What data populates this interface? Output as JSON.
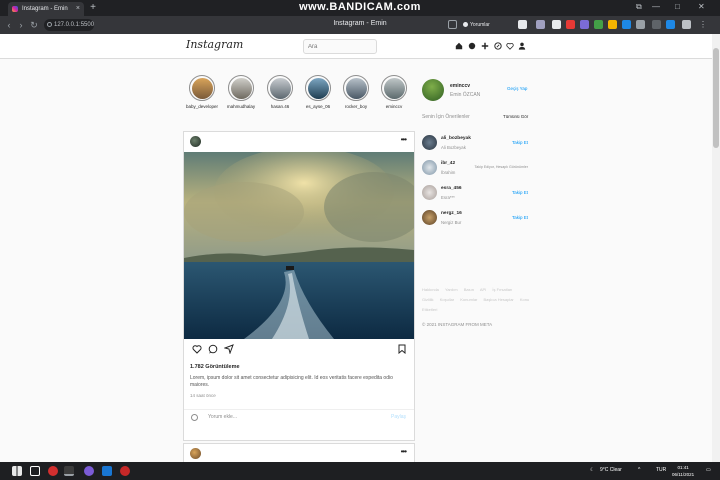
{
  "browser": {
    "tab_title": "Instagram - Emin",
    "tab_close": "×",
    "new_tab": "+",
    "recorder_watermark": "www.BANDICAM.com",
    "page_title": "Instagram - Emin",
    "url": "127.0.0.1:5500",
    "comments_ext_label": "Yorumlar",
    "window_controls": [
      "⧉",
      "—",
      "□",
      "✕"
    ]
  },
  "header": {
    "logo": "Instagram",
    "search_placeholder": "Ara"
  },
  "stories": [
    {
      "name": "baby_developer",
      "color": "#c79560"
    },
    {
      "name": "mahmudhalay",
      "color": "#a89c8a"
    },
    {
      "name": "hasan.46",
      "color": "#8b9aa5"
    },
    {
      "name": "es_ayse_06",
      "color": "#3f6d8a"
    },
    {
      "name": "rocker_boy",
      "color": "#6a7d8c"
    },
    {
      "name": "eminccv",
      "color": "#7e8c8f"
    }
  ],
  "post": {
    "menu": "•••",
    "views": "1.782 Görüntüleme",
    "caption": "Lorem, ipsum dolor sit amet consectetur adipisicing elit. Id eos veritatis facere expedita odio maiores.",
    "time": "14 saat önce",
    "comment_placeholder": "Yorum ekle...",
    "comment_button": "Paylaş",
    "menu2": "•••"
  },
  "sidebar": {
    "username": "eminccv",
    "fullname": "Emin ÖZCAN",
    "switch": "Geçiş Yap",
    "suggestions_title": "Senin İçin Önerilenler",
    "see_all": "Tümünü Gör",
    "suggestions": [
      {
        "username": "ali_bozbeyak",
        "name": "Ali Bozbeyak",
        "action": "Takip Et",
        "color": "#4a5a6a"
      },
      {
        "username": "ibr_42",
        "name": "İbrahim",
        "action": "Takip Ediyor, Hesaplı Görünümler",
        "color": "#7f95a8"
      },
      {
        "username": "esra_456",
        "name": "Esra***",
        "action": "Takip Et",
        "color": "#c2b9b5"
      },
      {
        "username": "nergz_16",
        "name": "Nergiz Bur",
        "action": "Takip Et",
        "color": "#8a6d4a"
      }
    ],
    "footer_links": [
      "Hakkında",
      "Yardım",
      "Basın",
      "API",
      "İş Fırsatları",
      "Gizlilik",
      "Koşullar",
      "Konumlar",
      "Başlıca Hesaplar",
      "Konu Etiketleri"
    ],
    "copyright": "© 2021 INSTAGRAM FROM META"
  },
  "taskbar": {
    "weather": "9°C Clear",
    "lang": "TUR",
    "time": "01:41",
    "date": "06/11/2021"
  }
}
